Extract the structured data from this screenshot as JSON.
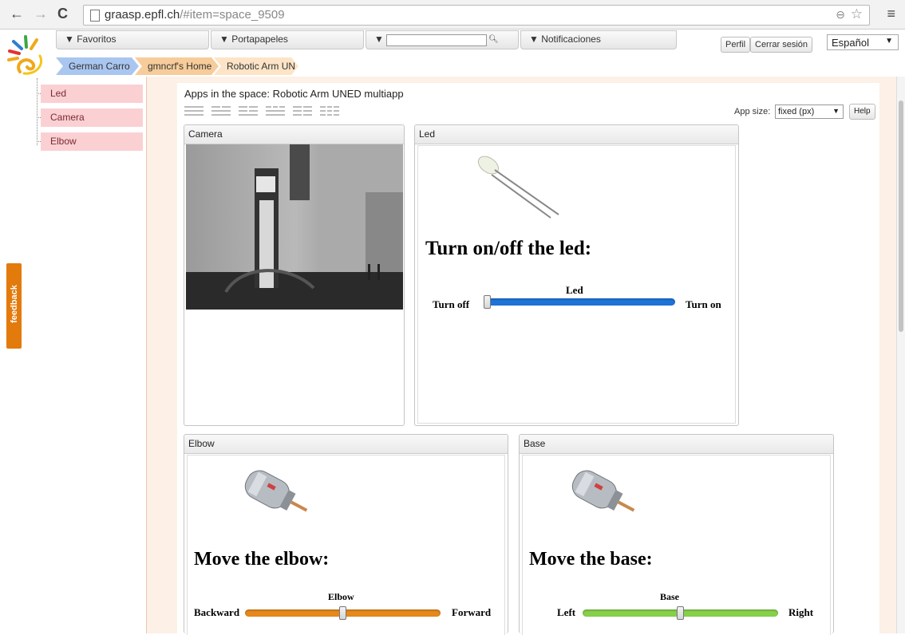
{
  "browser": {
    "url_domain": "graasp.epfl.ch",
    "url_path": "/#item=space_9509",
    "back_icon": "←",
    "forward_icon": "→",
    "reload_icon": "C",
    "zoom_icon": "⊖",
    "star_icon": "☆",
    "menu_icon": "≡"
  },
  "topbar": {
    "favorites": "▼ Favoritos",
    "clipboard": "▼ Portapapeles",
    "search_toggle": "▼",
    "notifications": "▼ Notificaciones",
    "profile": "Perfil",
    "logout": "Cerrar sesión",
    "language": "Español"
  },
  "breadcrumb": [
    "German Carro",
    "gmncrf's Home",
    "Robotic Arm UN"
  ],
  "sidebar": {
    "items": [
      "Led",
      "Camera",
      "Elbow"
    ]
  },
  "main": {
    "title": "Apps in the space: Robotic Arm UNED multiapp",
    "app_size_label": "App size:",
    "app_size_value": "fixed (px)",
    "help": "Help"
  },
  "apps": {
    "camera": {
      "header": "Camera"
    },
    "led": {
      "header": "Led",
      "heading": "Turn on/off the led:",
      "slider_title": "Led",
      "left_label": "Turn off",
      "right_label": "Turn on",
      "slider_value": 0,
      "track_color": "#1e73d8"
    },
    "elbow": {
      "header": "Elbow",
      "heading": "Move the elbow:",
      "slider_title": "Elbow",
      "left_label": "Backward",
      "right_label": "Forward",
      "slider_value": 0.5,
      "track_color": "#e6891a"
    },
    "base": {
      "header": "Base",
      "heading": "Move the base:",
      "slider_title": "Base",
      "left_label": "Left",
      "right_label": "Right",
      "slider_value": 0.5,
      "track_color": "#86d04a"
    }
  },
  "feedback": "feedback",
  "colors": {
    "accent_orange": "#e37a0c",
    "sidebar_pink": "#fbd0d3",
    "crumb_blue": "#a9c6f0",
    "crumb_orange": "#f7cc9a"
  }
}
